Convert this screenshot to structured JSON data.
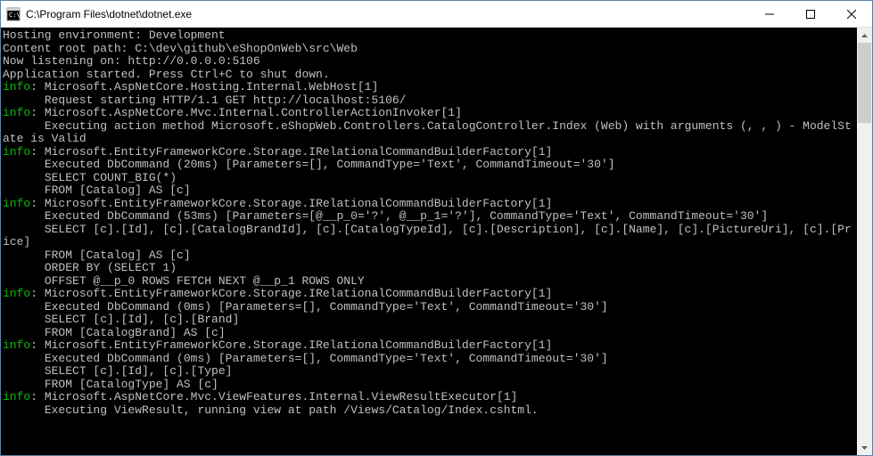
{
  "window": {
    "title": "C:\\Program Files\\dotnet\\dotnet.exe"
  },
  "log": {
    "lines": [
      {
        "prefix": "",
        "text": "Hosting environment: Development"
      },
      {
        "prefix": "",
        "text": "Content root path: C:\\dev\\github\\eShopOnWeb\\src\\Web"
      },
      {
        "prefix": "",
        "text": "Now listening on: http://0.0.0.0:5106"
      },
      {
        "prefix": "",
        "text": "Application started. Press Ctrl+C to shut down."
      },
      {
        "prefix": "info",
        "text": ": Microsoft.AspNetCore.Hosting.Internal.WebHost[1]"
      },
      {
        "prefix": "",
        "text": "      Request starting HTTP/1.1 GET http://localhost:5106/"
      },
      {
        "prefix": "info",
        "text": ": Microsoft.AspNetCore.Mvc.Internal.ControllerActionInvoker[1]"
      },
      {
        "prefix": "",
        "text": "      Executing action method Microsoft.eShopWeb.Controllers.CatalogController.Index (Web) with arguments (, , ) - ModelState is Valid"
      },
      {
        "prefix": "info",
        "text": ": Microsoft.EntityFrameworkCore.Storage.IRelationalCommandBuilderFactory[1]"
      },
      {
        "prefix": "",
        "text": "      Executed DbCommand (20ms) [Parameters=[], CommandType='Text', CommandTimeout='30']"
      },
      {
        "prefix": "",
        "text": "      SELECT COUNT_BIG(*)"
      },
      {
        "prefix": "",
        "text": "      FROM [Catalog] AS [c]"
      },
      {
        "prefix": "info",
        "text": ": Microsoft.EntityFrameworkCore.Storage.IRelationalCommandBuilderFactory[1]"
      },
      {
        "prefix": "",
        "text": "      Executed DbCommand (53ms) [Parameters=[@__p_0='?', @__p_1='?'], CommandType='Text', CommandTimeout='30']"
      },
      {
        "prefix": "",
        "text": "      SELECT [c].[Id], [c].[CatalogBrandId], [c].[CatalogTypeId], [c].[Description], [c].[Name], [c].[PictureUri], [c].[Price]"
      },
      {
        "prefix": "",
        "text": "      FROM [Catalog] AS [c]"
      },
      {
        "prefix": "",
        "text": "      ORDER BY (SELECT 1)"
      },
      {
        "prefix": "",
        "text": "      OFFSET @__p_0 ROWS FETCH NEXT @__p_1 ROWS ONLY"
      },
      {
        "prefix": "info",
        "text": ": Microsoft.EntityFrameworkCore.Storage.IRelationalCommandBuilderFactory[1]"
      },
      {
        "prefix": "",
        "text": "      Executed DbCommand (0ms) [Parameters=[], CommandType='Text', CommandTimeout='30']"
      },
      {
        "prefix": "",
        "text": "      SELECT [c].[Id], [c].[Brand]"
      },
      {
        "prefix": "",
        "text": "      FROM [CatalogBrand] AS [c]"
      },
      {
        "prefix": "info",
        "text": ": Microsoft.EntityFrameworkCore.Storage.IRelationalCommandBuilderFactory[1]"
      },
      {
        "prefix": "",
        "text": "      Executed DbCommand (0ms) [Parameters=[], CommandType='Text', CommandTimeout='30']"
      },
      {
        "prefix": "",
        "text": "      SELECT [c].[Id], [c].[Type]"
      },
      {
        "prefix": "",
        "text": "      FROM [CatalogType] AS [c]"
      },
      {
        "prefix": "info",
        "text": ": Microsoft.AspNetCore.Mvc.ViewFeatures.Internal.ViewResultExecutor[1]"
      },
      {
        "prefix": "",
        "text": "      Executing ViewResult, running view at path /Views/Catalog/Index.cshtml."
      }
    ]
  }
}
